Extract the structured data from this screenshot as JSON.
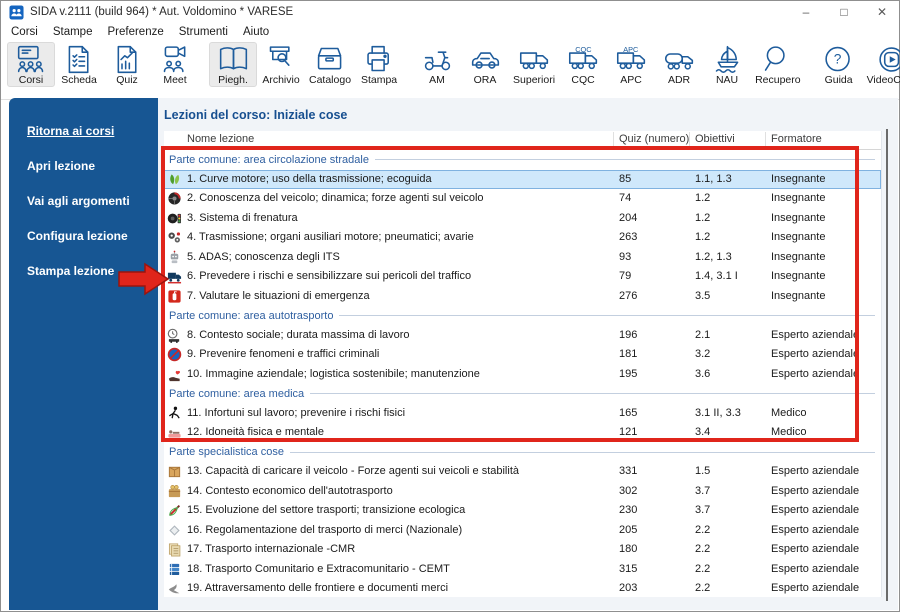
{
  "window": {
    "title": "SIDA v.2111 (build 964) * Aut. Voldomino * VARESE",
    "controls": [
      "–",
      "□",
      "✕"
    ]
  },
  "menu": {
    "items": [
      "Corsi",
      "Stampe",
      "Preferenze",
      "Strumenti",
      "Aiuto"
    ]
  },
  "toolbar": {
    "groups": [
      {
        "buttons": [
          {
            "label": "Corsi",
            "icon": "corsi",
            "pressed": true
          },
          {
            "label": "Scheda",
            "icon": "scheda",
            "pressed": false
          },
          {
            "label": "Quiz",
            "icon": "quiz",
            "pressed": false
          },
          {
            "label": "Meet",
            "icon": "meet",
            "pressed": false
          }
        ]
      },
      {
        "buttons": [
          {
            "label": "Piegh.",
            "icon": "piegh",
            "pressed": true
          },
          {
            "label": "Archivio",
            "icon": "archivio",
            "pressed": false
          },
          {
            "label": "Catalogo",
            "icon": "catalogo",
            "pressed": false
          },
          {
            "label": "Stampa",
            "icon": "stampa",
            "pressed": false
          }
        ]
      },
      {
        "buttons": [
          {
            "label": "AM",
            "icon": "am",
            "pressed": false
          },
          {
            "label": "ORA",
            "icon": "ora",
            "pressed": false
          },
          {
            "label": "Superiori",
            "icon": "superiori",
            "pressed": false
          },
          {
            "label": "CQC",
            "icon": "cqc",
            "pressed": false
          },
          {
            "label": "APC",
            "icon": "apc",
            "pressed": false
          },
          {
            "label": "ADR",
            "icon": "adr",
            "pressed": false
          },
          {
            "label": "NAU",
            "icon": "nau",
            "pressed": false
          },
          {
            "label": "Recupero",
            "icon": "recupero",
            "pressed": false
          }
        ]
      },
      {
        "buttons": [
          {
            "label": "Guida",
            "icon": "guida",
            "pressed": false
          },
          {
            "label": "VideoCorsi",
            "icon": "videocorsi",
            "pressed": false
          }
        ]
      }
    ]
  },
  "sidebar": {
    "items": [
      {
        "label": "Ritorna ai corsi",
        "underline": true
      },
      {
        "label": "Apri lezione",
        "underline": false
      },
      {
        "label": "Vai agli argomenti",
        "underline": false
      },
      {
        "label": "Configura lezione",
        "underline": false
      },
      {
        "label": "Stampa lezione",
        "underline": false
      }
    ]
  },
  "main": {
    "title": "Lezioni del corso: Iniziale cose",
    "table": {
      "columns": [
        "Nome lezione",
        "Quiz (numero)",
        "Obiettivi",
        "Formatore"
      ],
      "rows": [
        {
          "type": "section",
          "label": "Parte comune: area circolazione stradale"
        },
        {
          "type": "lesson",
          "icon": "eco-leaves",
          "name": "1. Curve motore; uso della trasmissione; ecoguida",
          "quiz": "85",
          "obiettivi": "1.1, 1.3",
          "formatore": "Insegnante",
          "selected": true
        },
        {
          "type": "lesson",
          "icon": "steering-wheel",
          "name": "2. Conoscenza del veicolo; dinamica; forze agenti sul veicolo",
          "quiz": "74",
          "obiettivi": "1.2",
          "formatore": "Insegnante"
        },
        {
          "type": "lesson",
          "icon": "tire-trafficlight",
          "name": "3. Sistema di frenatura",
          "quiz": "204",
          "obiettivi": "1.2",
          "formatore": "Insegnante"
        },
        {
          "type": "lesson",
          "icon": "gears",
          "name": "4. Trasmissione; organi ausiliari motore; pneumatici; avarie",
          "quiz": "263",
          "obiettivi": "1.2",
          "formatore": "Insegnante"
        },
        {
          "type": "lesson",
          "icon": "adas-robot",
          "name": "5. ADAS; conoscenza degli ITS",
          "quiz": "93",
          "obiettivi": "1.2, 1.3",
          "formatore": "Insegnante"
        },
        {
          "type": "lesson",
          "icon": "truck-risk",
          "name": "6. Prevedere i rischi e sensibilizzare sui pericoli del traffico",
          "quiz": "79",
          "obiettivi": "1.4, 3.1 I",
          "formatore": "Insegnante"
        },
        {
          "type": "lesson",
          "icon": "emergency",
          "name": "7. Valutare le situazioni di emergenza",
          "quiz": "276",
          "obiettivi": "3.5",
          "formatore": "Insegnante"
        },
        {
          "type": "section",
          "label": "Parte comune: area autotrasporto"
        },
        {
          "type": "lesson",
          "icon": "clock-work",
          "name": "8. Contesto sociale; durata massima di lavoro",
          "quiz": "196",
          "obiettivi": "2.1",
          "formatore": "Esperto aziendale"
        },
        {
          "type": "lesson",
          "icon": "no-entry",
          "name": "9. Prevenire fenomeni e traffici criminali",
          "quiz": "181",
          "obiettivi": "3.2",
          "formatore": "Esperto aziendale"
        },
        {
          "type": "lesson",
          "icon": "care-hand",
          "name": "10. Immagine aziendale; logistica sostenibile; manutenzione",
          "quiz": "195",
          "obiettivi": "3.6",
          "formatore": "Esperto aziendale"
        },
        {
          "type": "section",
          "label": "Parte comune: area medica"
        },
        {
          "type": "lesson",
          "icon": "slip-person",
          "name": "11. Infortuni sul lavoro; prevenire i rischi fisici",
          "quiz": "165",
          "obiettivi": "3.1 II, 3.3",
          "formatore": "Medico"
        },
        {
          "type": "lesson",
          "icon": "therapy",
          "name": "12. Idoneità fisica e mentale",
          "quiz": "121",
          "obiettivi": "3.4",
          "formatore": "Medico"
        },
        {
          "type": "section",
          "label": "Parte specialistica cose"
        },
        {
          "type": "lesson",
          "icon": "cargo-box",
          "name": "13. Capacità di caricare il veicolo - Forze agenti sui veicoli e stabilità",
          "quiz": "331",
          "obiettivi": "1.5",
          "formatore": "Esperto aziendale"
        },
        {
          "type": "lesson",
          "icon": "economy",
          "name": "14. Contesto economico dell'autotrasporto",
          "quiz": "302",
          "obiettivi": "3.7",
          "formatore": "Esperto aziendale"
        },
        {
          "type": "lesson",
          "icon": "eco-pen",
          "name": "15. Evoluzione del settore trasporti; transizione ecologica",
          "quiz": "230",
          "obiettivi": "3.7",
          "formatore": "Esperto aziendale"
        },
        {
          "type": "lesson",
          "icon": "diamond",
          "name": "16. Regolamentazione del trasporto di merci (Nazionale)",
          "quiz": "205",
          "obiettivi": "2.2",
          "formatore": "Esperto aziendale"
        },
        {
          "type": "lesson",
          "icon": "documents",
          "name": "17. Trasporto internazionale -CMR",
          "quiz": "180",
          "obiettivi": "2.2",
          "formatore": "Esperto aziendale"
        },
        {
          "type": "lesson",
          "icon": "books",
          "name": "18. Trasporto Comunitario e Extracomunitario - CEMT",
          "quiz": "315",
          "obiettivi": "2.2",
          "formatore": "Esperto aziendale"
        },
        {
          "type": "lesson",
          "icon": "bird",
          "name": "19. Attraversamento delle frontiere e documenti merci",
          "quiz": "203",
          "obiettivi": "2.2",
          "formatore": "Esperto aziendale"
        }
      ]
    }
  },
  "colors": {
    "sidebar_navy": "#175693",
    "icon_navy": "#1e5c9c",
    "title_blue": "#174f90",
    "section_blue": "#2f5fa0",
    "selection_bg": "#cfe8fb",
    "annotation_red": "#e0251b"
  }
}
